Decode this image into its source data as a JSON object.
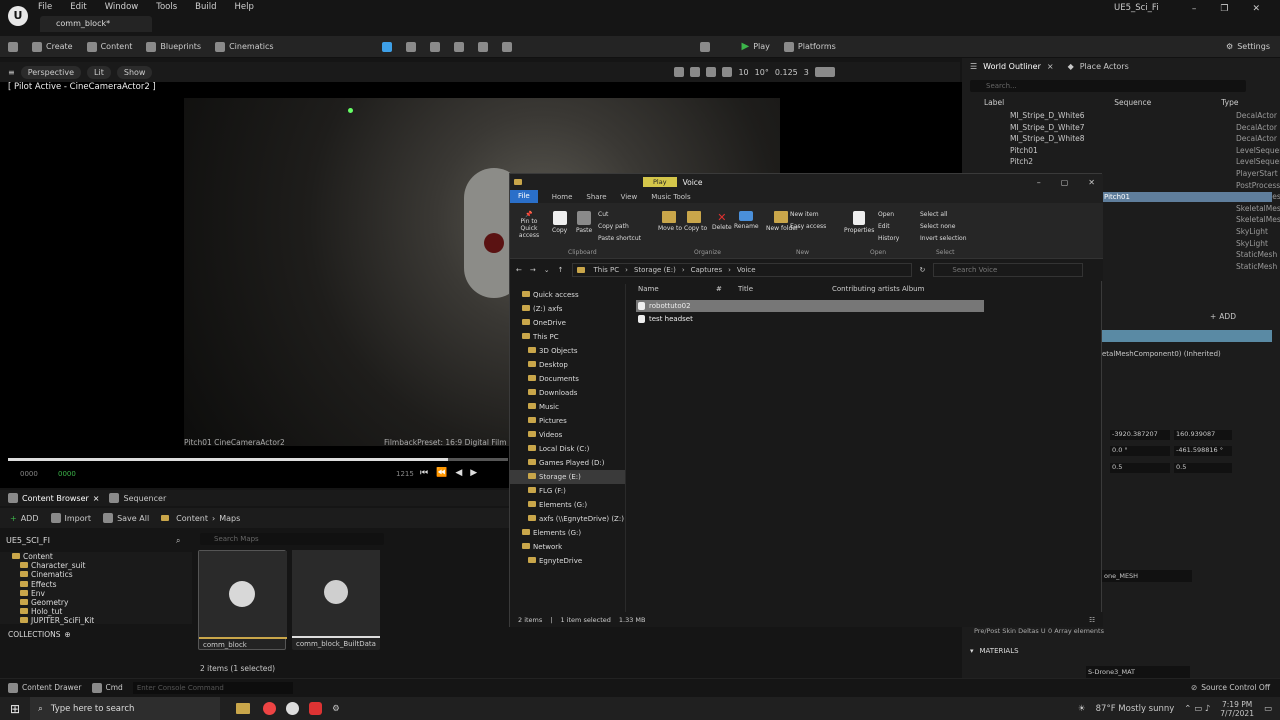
{
  "app": {
    "logo": "U",
    "menu": [
      "File",
      "Edit",
      "Window",
      "Tools",
      "Build",
      "Help"
    ],
    "tab_title": "comm_block*",
    "project_name": "UE5_Sci_Fi"
  },
  "toolbar": {
    "create": "Create",
    "content": "Content",
    "blueprints": "Blueprints",
    "cinematics": "Cinematics",
    "play": "Play",
    "platforms": "Platforms",
    "settings": "Settings"
  },
  "viewport": {
    "perspective": "Perspective",
    "lit": "Lit",
    "show": "Show",
    "grid_snap": "10",
    "rot_snap": "10°",
    "scale_snap": "0.125",
    "cam_speed": "3",
    "pilot_label": "[ Pilot Active - CineCameraActor2 ]",
    "caption_left": "Pitch01 CineCameraActor2",
    "caption_right": "FilmbackPreset: 16:9 Digital Film | Z",
    "timecode_start": "0000",
    "timecode_current": "0000",
    "timecode_end": "1215"
  },
  "content_browser": {
    "tab_label": "Content Browser",
    "sequencer_label": "Sequencer",
    "add": "ADD",
    "import": "Import",
    "save_all": "Save All",
    "breadcrumb": [
      "Content",
      "Maps"
    ],
    "project_root": "UE5_SCI_FI",
    "search_placeholder": "Search Maps",
    "tree": [
      "Content",
      "Character_suit",
      "Cinematics",
      "Effects",
      "Env",
      "Geometry",
      "Holo_tut",
      "JUPITER_SciFi_Kit"
    ],
    "collections": "COLLECTIONS",
    "assets": [
      {
        "name": "comm_block"
      },
      {
        "name": "comm_block_BuiltData"
      }
    ],
    "status": "2 items (1 selected)"
  },
  "outliner": {
    "tab_label": "World Outliner",
    "place_actors": "Place Actors",
    "search_placeholder": "Search...",
    "col_label": "Label",
    "col_sequence": "Sequence",
    "col_type": "Type",
    "rows": [
      {
        "label": "MI_Stripe_D_White6",
        "type": "DecalActor"
      },
      {
        "label": "MI_Stripe_D_White7",
        "type": "DecalActor"
      },
      {
        "label": "MI_Stripe_D_White8",
        "type": "DecalActor"
      },
      {
        "label": "Pitch01",
        "type": "LevelSequer"
      },
      {
        "label": "Pitch2",
        "type": "LevelSequer"
      },
      {
        "label": "",
        "type": "PlayerStart"
      },
      {
        "label": "",
        "type": "PostProcess"
      },
      {
        "label": "",
        "type": "SkeletalMes"
      },
      {
        "label": "",
        "type": "SkeletalMes"
      },
      {
        "label": "",
        "type": "SkeletalMes"
      },
      {
        "label": "",
        "type": "SkyLight"
      },
      {
        "label": "",
        "type": "SkyLight"
      },
      {
        "label": "",
        "type": "StaticMesh"
      },
      {
        "label": "",
        "type": "StaticMesh"
      }
    ],
    "selected_partial": "Pitch01"
  },
  "details": {
    "add": "ADD",
    "component": "etalMeshComponent0) (Inherited)",
    "loc_x": "-3920.387207",
    "loc_y": "160.939087",
    "rot_x": "0.0 °",
    "rot_y": "-461.598816 °",
    "scale_x": "0.5",
    "scale_y": "0.5",
    "mesh": "one_MESH",
    "skin_deltas_label": "Pre/Post Skin Deltas U",
    "array_elements": "0 Array elements",
    "materials_header": "MATERIALS",
    "material": "S-Drone3_MAT"
  },
  "explorer": {
    "title": "Voice",
    "play_tab": "Play",
    "ribbon_tabs": [
      "File",
      "Home",
      "Share",
      "View",
      "Music Tools"
    ],
    "clipboard": {
      "pin": "Pin to Quick access",
      "copy": "Copy",
      "paste": "Paste",
      "cut": "Cut",
      "copy_path": "Copy path",
      "paste_shortcut": "Paste shortcut",
      "group": "Clipboard"
    },
    "organize": {
      "move_to": "Move to",
      "copy_to": "Copy to",
      "delete": "Delete",
      "rename": "Rename",
      "group": "Organize"
    },
    "new": {
      "new_folder": "New folder",
      "new_item": "New item",
      "easy_access": "Easy access",
      "group": "New"
    },
    "open": {
      "properties": "Properties",
      "open": "Open",
      "edit": "Edit",
      "history": "History",
      "group": "Open"
    },
    "select": {
      "select_all": "Select all",
      "select_none": "Select none",
      "invert": "Invert selection",
      "group": "Select"
    },
    "path": [
      "This PC",
      "Storage (E:)",
      "Captures",
      "Voice"
    ],
    "search_placeholder": "Search Voice",
    "nav": [
      {
        "label": "Quick access",
        "indent": 1
      },
      {
        "label": "(Z:) axfs",
        "indent": 1
      },
      {
        "label": "OneDrive",
        "indent": 1
      },
      {
        "label": "This PC",
        "indent": 1
      },
      {
        "label": "3D Objects",
        "indent": 2
      },
      {
        "label": "Desktop",
        "indent": 2
      },
      {
        "label": "Documents",
        "indent": 2
      },
      {
        "label": "Downloads",
        "indent": 2
      },
      {
        "label": "Music",
        "indent": 2
      },
      {
        "label": "Pictures",
        "indent": 2
      },
      {
        "label": "Videos",
        "indent": 2
      },
      {
        "label": "Local Disk (C:)",
        "indent": 2
      },
      {
        "label": "Games Played (D:)",
        "indent": 2
      },
      {
        "label": "Storage (E:)",
        "indent": 2
      },
      {
        "label": "FLG (F:)",
        "indent": 2
      },
      {
        "label": "Elements (G:)",
        "indent": 2
      },
      {
        "label": "axfs (\\\\EgnyteDrive) (Z:)",
        "indent": 2
      },
      {
        "label": "Elements (G:)",
        "indent": 1
      },
      {
        "label": "Network",
        "indent": 1
      },
      {
        "label": "EgnyteDrive",
        "indent": 2
      }
    ],
    "columns": [
      "Name",
      "#",
      "Title",
      "Contributing artists",
      "Album"
    ],
    "files": [
      {
        "name": "robottuto02",
        "selected": true
      },
      {
        "name": "test headset",
        "selected": false
      }
    ],
    "status_items": "2 items",
    "status_selected": "1 item selected",
    "status_size": "1.33 MB"
  },
  "statusbar": {
    "content_drawer": "Content Drawer",
    "cmd": "Cmd",
    "console_placeholder": "Enter Console Command",
    "source_control": "Source Control Off"
  },
  "taskbar": {
    "search_placeholder": "Type here to search",
    "weather": "87°F  Mostly sunny",
    "time": "7:19 PM",
    "date": "7/7/2021"
  },
  "colors": {
    "play_green": "#3cb54a",
    "select_blue": "#3ea0e8",
    "folder_gold": "#c9a64a"
  }
}
